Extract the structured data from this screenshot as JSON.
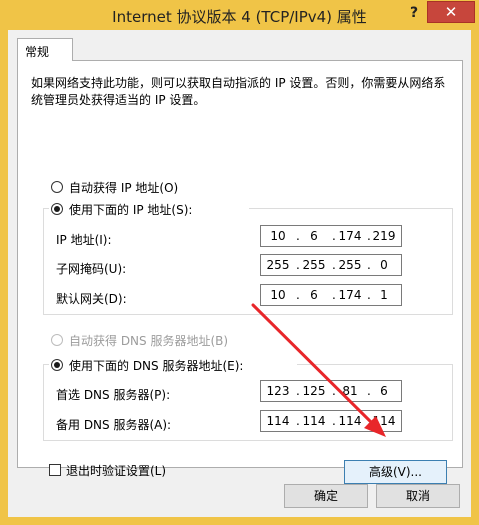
{
  "window": {
    "title": "Internet 协议版本 4 (TCP/IPv4) 属性",
    "help": "?",
    "close": "✕"
  },
  "tab": {
    "label": "常规"
  },
  "description": "如果网络支持此功能，则可以获取自动指派的 IP 设置。否则，你需要从网络系统管理员处获得适当的 IP 设置。",
  "ip": {
    "auto_label": "自动获得 IP 地址(O)",
    "manual_label": "使用下面的 IP 地址(S):",
    "address_label": "IP 地址(I):",
    "address": [
      "10",
      "6",
      "174",
      "219"
    ],
    "subnet_label": "子网掩码(U):",
    "subnet": [
      "255",
      "255",
      "255",
      "0"
    ],
    "gateway_label": "默认网关(D):",
    "gateway": [
      "10",
      "6",
      "174",
      "1"
    ]
  },
  "dns": {
    "auto_label": "自动获得 DNS 服务器地址(B)",
    "manual_label": "使用下面的 DNS 服务器地址(E):",
    "preferred_label": "首选 DNS 服务器(P):",
    "preferred": [
      "123",
      "125",
      "81",
      "6"
    ],
    "alternate_label": "备用 DNS 服务器(A):",
    "alternate": [
      "114",
      "114",
      "114",
      "114"
    ]
  },
  "validate_label": "退出时验证设置(L)",
  "advanced_label": "高级(V)...",
  "ok_label": "确定",
  "cancel_label": "取消",
  "colors": {
    "title_bar": "#f0c447",
    "close_button": "#c7463c",
    "arrow": "#e8262a"
  }
}
